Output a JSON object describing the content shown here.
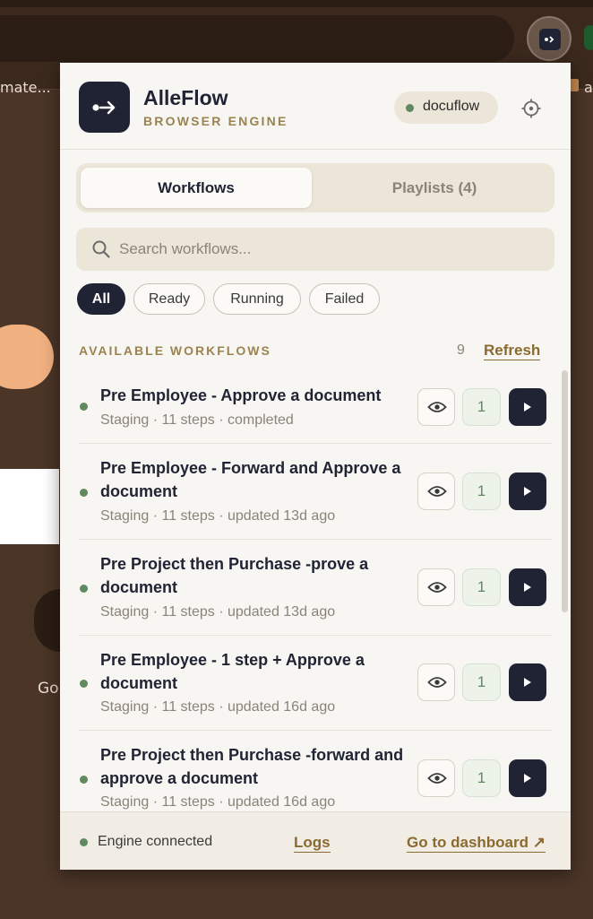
{
  "browser": {
    "bookmark_partial": "mate...",
    "bookmark_partial_right": "a",
    "page_partial_text": "Go"
  },
  "popup": {
    "brand_name": "AlleFlow",
    "brand_subtitle": "BROWSER ENGINE",
    "account": "docuflow",
    "tabs": [
      {
        "label": "Workflows",
        "active": true
      },
      {
        "label": "Playlists (4)",
        "active": false
      }
    ],
    "search_placeholder": "Search workflows...",
    "filters": [
      "All",
      "Ready",
      "Running",
      "Failed"
    ],
    "active_filter": "All",
    "section_label": "AVAILABLE WORKFLOWS",
    "workflow_count": "9",
    "refresh_label": "Refresh",
    "workflows": [
      {
        "title": "Pre Employee - Approve a document",
        "meta": "Staging · 11 steps · completed",
        "count": "1"
      },
      {
        "title": "Pre Employee - Forward and Approve a document",
        "meta": "Staging · 11 steps · updated 13d ago",
        "count": "1"
      },
      {
        "title": "Pre Project then Purchase -prove a document",
        "meta": "Staging · 11 steps · updated 13d ago",
        "count": "1"
      },
      {
        "title": "Pre Employee - 1 step + Approve a document",
        "meta": "Staging · 11 steps · updated 16d ago",
        "count": "1"
      },
      {
        "title": "Pre Project then Purchase -forward and approve a document",
        "meta": "Staging · 11 steps · updated 16d ago",
        "count": "1"
      }
    ],
    "footer": {
      "status": "Engine connected",
      "logs_label": "Logs",
      "dashboard_label": "Go to dashboard ↗"
    },
    "colors": {
      "accent_dark": "#1f2333",
      "gold": "#9a8350",
      "status_green": "#5f8a5f"
    },
    "icons": [
      "alleflow-logo-icon",
      "settings-icon",
      "search-icon",
      "eye-icon",
      "play-icon",
      "status-dot-icon"
    ]
  }
}
